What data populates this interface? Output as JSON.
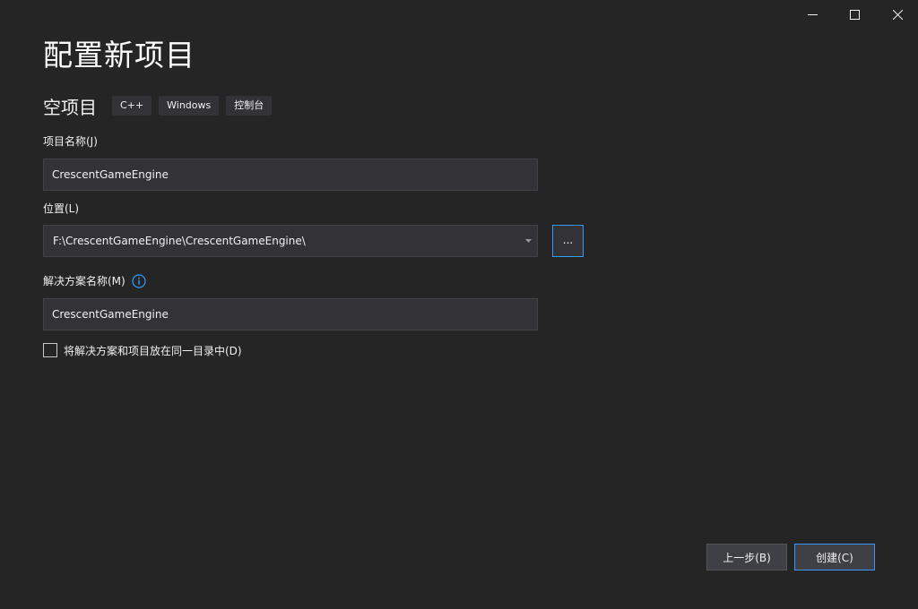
{
  "window": {
    "minimize_icon": "minimize-icon",
    "maximize_icon": "maximize-icon",
    "close_icon": "close-icon"
  },
  "page": {
    "title": "配置新项目"
  },
  "template": {
    "name": "空项目",
    "tags": [
      "C++",
      "Windows",
      "控制台"
    ]
  },
  "project_name": {
    "label": "项目名称(J)",
    "value": "CrescentGameEngine"
  },
  "location": {
    "label": "位置(L)",
    "value": "F:\\CrescentGameEngine\\CrescentGameEngine\\",
    "browse_label": "..."
  },
  "solution_name": {
    "label": "解决方案名称(M)",
    "value": "CrescentGameEngine",
    "info_icon": "info-icon"
  },
  "same_directory": {
    "label": "将解决方案和项目放在同一目录中(D)",
    "checked": false
  },
  "buttons": {
    "back_label": "上一步(B)",
    "create_label": "创建(C)"
  },
  "colors": {
    "background": "#252526",
    "input_background": "#333337",
    "accent": "#3399ff",
    "text": "#f1f1f1"
  }
}
